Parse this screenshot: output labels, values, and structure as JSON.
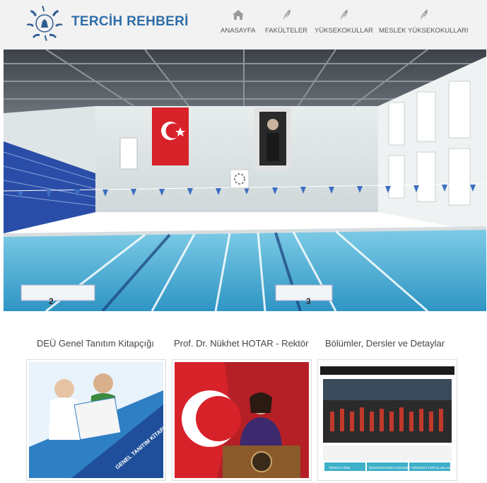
{
  "header": {
    "brand": "TERCİH REHBERİ",
    "nav": [
      {
        "label": "ANASAYFA",
        "icon": "home-icon"
      },
      {
        "label": "FAKÜLTELER",
        "icon": "feather-icon"
      },
      {
        "label": "YÜKSEKOKULLAR",
        "icon": "feather-icon"
      },
      {
        "label": "MESLEK YÜKSEKOKULLARI",
        "icon": "feather-icon"
      }
    ]
  },
  "hero": {
    "lane_numbers": [
      "2",
      "3"
    ]
  },
  "cards": [
    {
      "title": "DEÜ Genel Tanıtım Kitapçığı",
      "cover_text": "GENEL TANITIM KİTAPÇIĞI"
    },
    {
      "title": "Prof. Dr. Nükhet HOTAR - Rektör"
    },
    {
      "title": "Bölümler, Dersler ve Detaylar",
      "thumb_buttons": [
        "TERCİH / ZİNE",
        "ÜNİVERSİTEMİZ HAKKINDA",
        "ÖĞRENCİ TOPLULUKLARI"
      ]
    }
  ],
  "colors": {
    "brand": "#2f6ea8",
    "header_bg": "#f2f2f2",
    "nav_text": "#555555",
    "pool": "#4fb0d8"
  }
}
